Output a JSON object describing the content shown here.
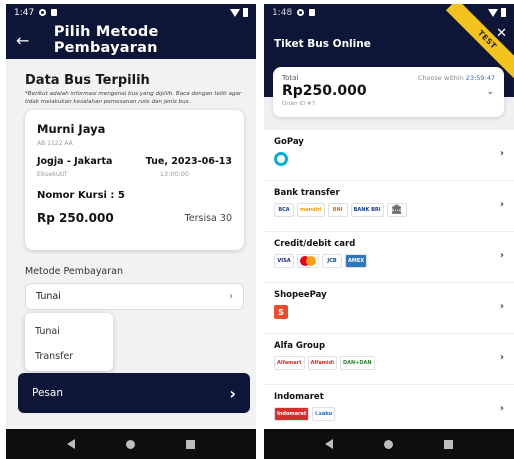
{
  "left": {
    "status": {
      "time": "1:47"
    },
    "appbar": {
      "title": "Pilih Metode Pembayaran"
    },
    "bus_section": {
      "title": "Data Bus Terpilih",
      "description": "*Berikut adalah informasi mengenai bus yang dipilih. Baca dengan teliti agar tidak melakukan kesalahan pemesanan rute dan jenis bus."
    },
    "bus": {
      "name": "Murni Jaya",
      "code": "AB 1122 AA",
      "route": "Jogja - Jakarta",
      "date": "Tue, 2023-06-13",
      "class": "Eksekutif",
      "time": "13:00:00",
      "seat_label": "Nomor Kursi : 5",
      "price": "Rp 250.000",
      "remaining": "Tersisa 30"
    },
    "payment": {
      "label": "Metode Pembayaran",
      "selected": "Tunai",
      "options": [
        "Tunai",
        "Transfer"
      ]
    },
    "order_button": "Pesan"
  },
  "right": {
    "status": {
      "time": "1:48"
    },
    "header": {
      "title": "Tiket Bus Online",
      "ribbon": "TEST"
    },
    "total": {
      "label": "Total",
      "amount": "Rp250.000",
      "order_id": "Order ID #7",
      "choose_prefix": "Choose within",
      "countdown": "23:59:47"
    },
    "methods": [
      {
        "name": "GoPay",
        "logos": []
      },
      {
        "name": "Bank transfer",
        "logos": [
          "BCA",
          "mandiri",
          "BNI",
          "BANK BRI",
          "bank-building-icon"
        ]
      },
      {
        "name": "Credit/debit card",
        "logos": [
          "VISA",
          "mastercard-icon",
          "JCB",
          "AMEX"
        ]
      },
      {
        "name": "ShopeePay",
        "logos": []
      },
      {
        "name": "Alfa Group",
        "logos": [
          "Alfamart",
          "Alfamidi",
          "DAN+DAN"
        ]
      },
      {
        "name": "Indomaret",
        "logos": [
          "Indomaret",
          "i.saku"
        ]
      }
    ]
  },
  "colors": {
    "navy": "#0d1637",
    "ribbon": "#f4c21c",
    "link": "#2f6ccd"
  }
}
